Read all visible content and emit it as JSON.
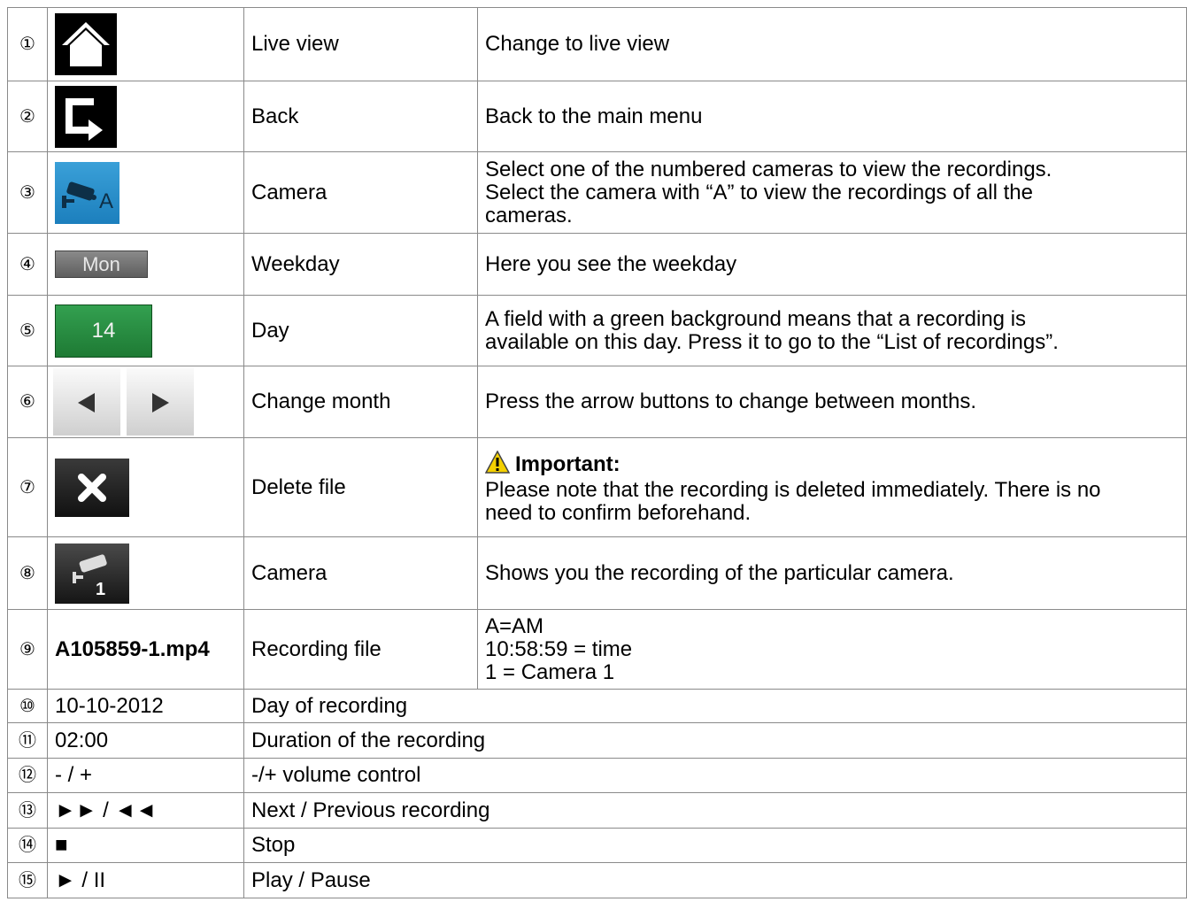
{
  "rows": [
    {
      "num": "①",
      "icon": "home-icon",
      "name": "Live view",
      "description": "Change to live view"
    },
    {
      "num": "②",
      "icon": "back-arrow-icon",
      "name": "Back",
      "description": "Back to the main menu"
    },
    {
      "num": "③",
      "icon": "camera-all-icon",
      "icon_text": "A",
      "name": "Camera",
      "description_lines": [
        "Select one of the numbered cameras to view the recordings.",
        "Select the camera with “A” to view the recordings of all the",
        "cameras."
      ]
    },
    {
      "num": "④",
      "icon_text": "Mon",
      "name": "Weekday",
      "description": "Here you see the weekday"
    },
    {
      "num": "⑤",
      "icon_text": "14",
      "name": "Day",
      "description_lines": [
        "A field with a green background means that a recording is",
        "available on this day. Press it to go to the “List of recordings”."
      ]
    },
    {
      "num": "⑥",
      "icon": "month-arrows-icon",
      "name": "Change month",
      "description": "Press the arrow buttons to change between months."
    },
    {
      "num": "⑦",
      "icon": "delete-x-icon",
      "name": "Delete file",
      "important_label": "Important:",
      "description_lines": [
        "Please note that the recording is deleted immediately. There is no",
        "need to confirm beforehand."
      ]
    },
    {
      "num": "⑧",
      "icon": "camera-1-icon",
      "icon_text": "1",
      "name": "Camera",
      "description": "Shows you the recording of the particular camera."
    },
    {
      "num": "⑨",
      "value": "A105859-1.mp4",
      "name": "Recording file",
      "description_lines": [
        "A=AM",
        "10:58:59 = time",
        "1 = Camera 1"
      ]
    },
    {
      "num": "⑩",
      "value": "10-10-2012",
      "name": "Day of recording"
    },
    {
      "num": "⑪",
      "value": "02:00",
      "name": "Duration of the recording"
    },
    {
      "num": "⑫",
      "value": "- / +",
      "name": "-/+ volume control"
    },
    {
      "num": "⑬",
      "value": "►► / ◄◄",
      "name": "Next / Previous recording"
    },
    {
      "num": "⑭",
      "value": "■",
      "name": "Stop"
    },
    {
      "num": "⑮",
      "value": "► / II",
      "name": "Play / Pause"
    }
  ],
  "colors": {
    "border": "#8a8a8a",
    "day_green": "#2a8f45",
    "camera_blue": "#2b8fcc"
  }
}
